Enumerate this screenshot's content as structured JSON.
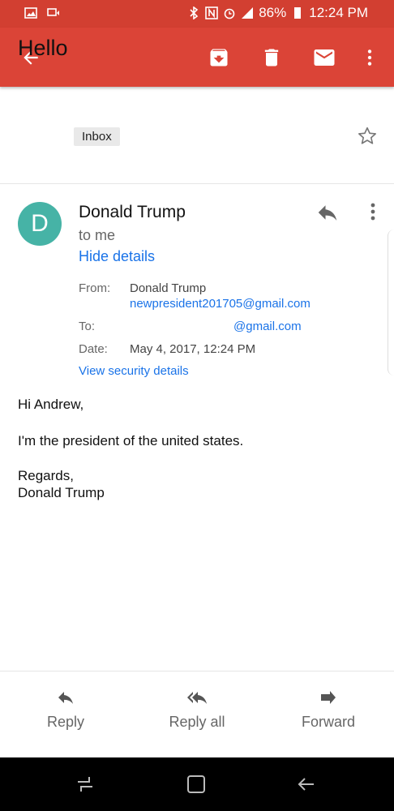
{
  "status_bar": {
    "battery": "86%",
    "time": "12:24 PM"
  },
  "app_bar": {
    "icons": [
      "back-arrow-icon",
      "archive-icon",
      "delete-icon",
      "mark-unread-icon",
      "more-vert-icon"
    ]
  },
  "email": {
    "subject": "Hello",
    "label": "Inbox",
    "avatar_letter": "D",
    "sender": "Donald Trump",
    "recipient_summary": "to me",
    "hide_details": "Hide details",
    "details": {
      "from_label": "From:",
      "from_name": "Donald Trump",
      "from_email": "newpresident201705@gmail.com",
      "to_label": "To:",
      "to_email": "@gmail.com",
      "date_label": "Date:",
      "date": "May 4, 2017, 12:24 PM"
    },
    "security": "View security details",
    "body": {
      "greeting": "Hi Andrew,",
      "line1": "I'm the president of the united states.",
      "closing": "Regards,",
      "signature": "Donald Trump"
    }
  },
  "actions": {
    "reply": "Reply",
    "reply_all": "Reply all",
    "forward": "Forward"
  },
  "colors": {
    "status_bar": "#d23f31",
    "app_bar": "#db4437",
    "avatar": "#46b3a6",
    "link": "#1a73e8"
  }
}
